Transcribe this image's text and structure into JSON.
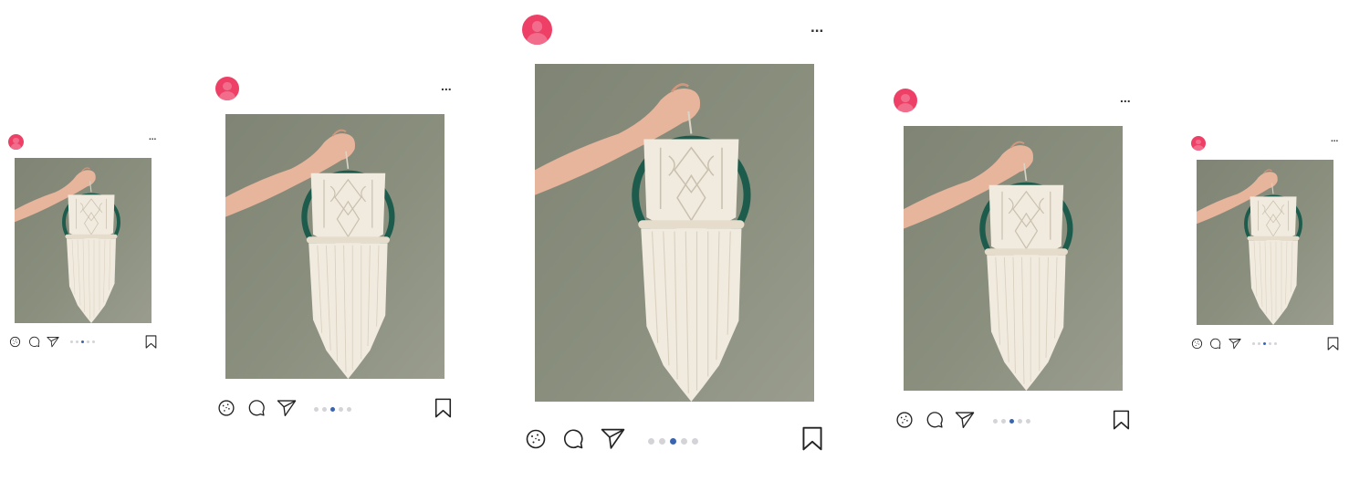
{
  "feed": {
    "posts": [
      {
        "id": "post-far-left",
        "more_label": "...",
        "carousel_count": 5,
        "carousel_active": 2
      },
      {
        "id": "post-left",
        "more_label": "...",
        "carousel_count": 5,
        "carousel_active": 2
      },
      {
        "id": "post-center",
        "more_label": "...",
        "carousel_count": 5,
        "carousel_active": 2
      },
      {
        "id": "post-right",
        "more_label": "...",
        "carousel_count": 5,
        "carousel_active": 2
      },
      {
        "id": "post-far-right",
        "more_label": "...",
        "carousel_count": 5,
        "carousel_active": 2
      }
    ],
    "icons": {
      "avatar": "user-avatar-icon",
      "like": "cookie-icon",
      "comment": "comment-bubble-icon",
      "share": "paper-plane-icon",
      "save": "bookmark-icon",
      "more": "more-dots-icon"
    },
    "colors": {
      "avatar": "#ee3f66",
      "active_dot": "#3b64b0",
      "inactive_dot": "#d4d4d8",
      "photo_wall": "#8a8f7e",
      "hoop": "#1d5c4c",
      "macrame": "#f1ebdf"
    }
  }
}
